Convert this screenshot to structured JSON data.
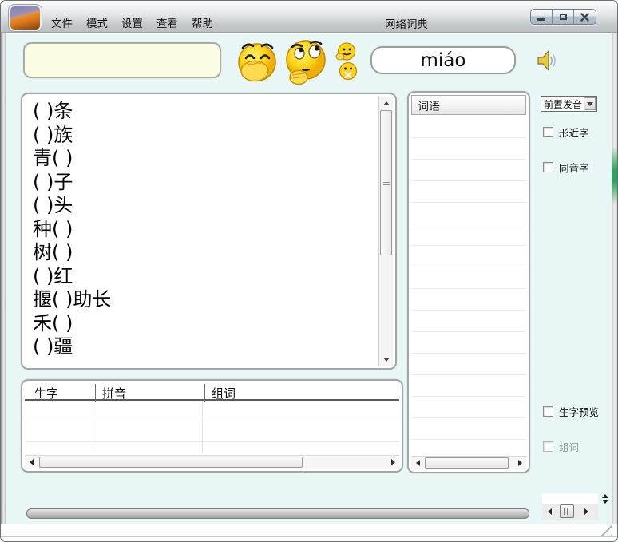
{
  "window": {
    "title": "网络词典",
    "menu": [
      "文件",
      "模式",
      "设置",
      "查看",
      "帮助"
    ]
  },
  "lookup": {
    "input_value": "",
    "pinyin": "miáo"
  },
  "exercises": [
    "( )条",
    "( )族",
    "青( )",
    "( )子",
    "( )头",
    "种( )",
    "树( )",
    "( )红",
    "揠( )助长",
    "禾( )",
    "( )疆"
  ],
  "word_list": {
    "header": "词语",
    "items": []
  },
  "options": {
    "pronounce_mode": "前置发音",
    "checkboxes": [
      {
        "label": "形近字",
        "checked": false,
        "disabled": false
      },
      {
        "label": "同音字",
        "checked": false,
        "disabled": false
      },
      {
        "label": "生字预览",
        "checked": false,
        "disabled": false
      },
      {
        "label": "组词",
        "checked": false,
        "disabled": true
      }
    ]
  },
  "table": {
    "headers": [
      "生字",
      "拼音",
      "组词"
    ],
    "rows": []
  },
  "icons": [
    "app-icon",
    "giggle-emoji",
    "thinking-emoji",
    "pointing-emoji",
    "mute-emoji",
    "speaker-icon"
  ],
  "colors": {
    "client_bg": "#e9f6f6",
    "input_bg": "#fcfce2",
    "titlebar": "#c7cacc",
    "accent_green": "#2ea05f"
  }
}
